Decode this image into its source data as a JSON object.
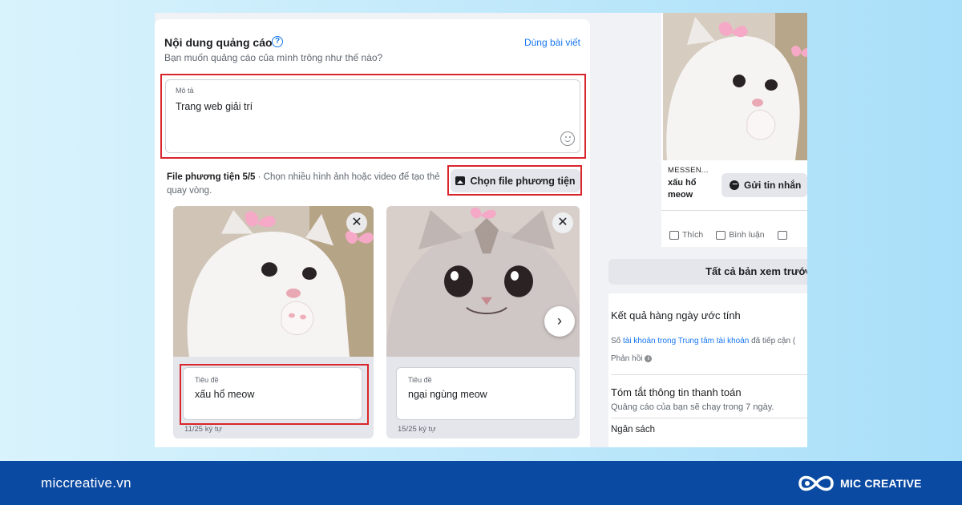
{
  "ad_content": {
    "title": "Nội dung quảng cáo",
    "help_icon": "question-circle",
    "subtitle": "Bạn muốn quảng cáo của mình trông như thế nào?",
    "use_post_link": "Dùng bài viết",
    "description": {
      "label": "Mô tả",
      "value": "Trang web giải trí",
      "emoji_icon": "smiley"
    },
    "media": {
      "label": "File phương tiện 5/5",
      "text": " · Chọn nhiều hình ảnh hoặc video để tạo thẻ quay vòng.",
      "choose_button": "Chọn file phương tiện",
      "choose_icon": "image"
    },
    "cards": [
      {
        "title_label": "Tiêu đề",
        "title_value": "xấu hổ meow",
        "char_count": "11/25 ký tự"
      },
      {
        "title_label": "Tiêu đề",
        "title_value": "ngại ngùng meow",
        "char_count": "15/25 ký tự"
      }
    ]
  },
  "preview": {
    "source": "MESSEN...",
    "title": "xấu hổ meow",
    "message_button": "Gửi tin nhắn",
    "actions": [
      "Thích",
      "Bình luận"
    ]
  },
  "all_previews_button": "Tất cả bản xem trước",
  "daily_results": {
    "heading": "Kết quả hàng ngày ước tính",
    "text_prefix": "Số ",
    "text_link": "tài khoản trong Trung tâm tài khoản",
    "text_suffix": " đã tiếp cận (",
    "feedback": "Phản hồi"
  },
  "payment": {
    "heading": "Tóm tắt thông tin thanh toán",
    "subtitle": "Quảng cáo của bạn sẽ chạy trong 7 ngày.",
    "budget": "Ngân sách"
  },
  "footer": {
    "url": "miccreative.vn",
    "brand": "MIC CREATIVE"
  },
  "colors": {
    "accent": "#1877f2",
    "highlight": "#d9262c",
    "footer_bg": "#0b4aa2"
  }
}
